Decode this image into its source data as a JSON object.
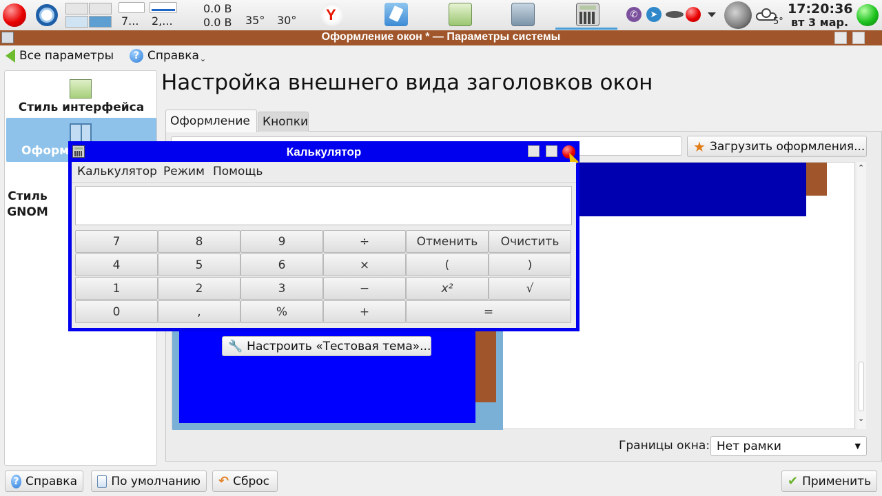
{
  "panel": {
    "net_label_1": "7...",
    "net_label_2": "2,...",
    "volt_1": "0.0 B",
    "volt_2": "0.0 B",
    "temp_1": "35°",
    "temp_2": "30°",
    "weather_temp": "5°",
    "clock_time": "17:20:36",
    "clock_date": "вт 3 мар."
  },
  "window": {
    "title": "Оформление окон * — Параметры системы"
  },
  "toolbar": {
    "all_settings": "Все параметры",
    "help": "Справка"
  },
  "sidebar": {
    "items": [
      {
        "label": "Стиль интерфейса"
      },
      {
        "label": "Оформ"
      },
      {
        "label": "Стиль"
      },
      {
        "label": "GNOM"
      }
    ]
  },
  "main": {
    "title": "Настройка внешнего вида заголовков окон",
    "tabs": [
      {
        "label": "Оформление"
      },
      {
        "label": "Кнопки"
      }
    ],
    "load_themes_button": "Загрузить оформления...",
    "configure_theme_button": "Настроить «Тестовая тема»...",
    "border_label": "Границы окна:",
    "border_value": "Нет рамки"
  },
  "bottom": {
    "help": "Справка",
    "defaults": "По умолчанию",
    "reset": "Сброс",
    "apply": "Применить"
  },
  "calculator": {
    "title": "Калькулятор",
    "menu": [
      "Калькулятор",
      "Режим",
      "Помощь"
    ],
    "keys": [
      [
        "7",
        "8",
        "9",
        "÷",
        "Отменить",
        "Очистить"
      ],
      [
        "4",
        "5",
        "6",
        "×",
        "(",
        ")"
      ],
      [
        "1",
        "2",
        "3",
        "−",
        "x²",
        "√"
      ],
      [
        "0",
        ",",
        "%",
        "+",
        "="
      ]
    ]
  },
  "colors": {
    "title_bar": "#a0562a",
    "calc_frame": "#0000ee",
    "preview_blue": "#0000ff",
    "preview_dark_blue": "#0000b0",
    "preview_light_blue": "#7aafd6"
  }
}
